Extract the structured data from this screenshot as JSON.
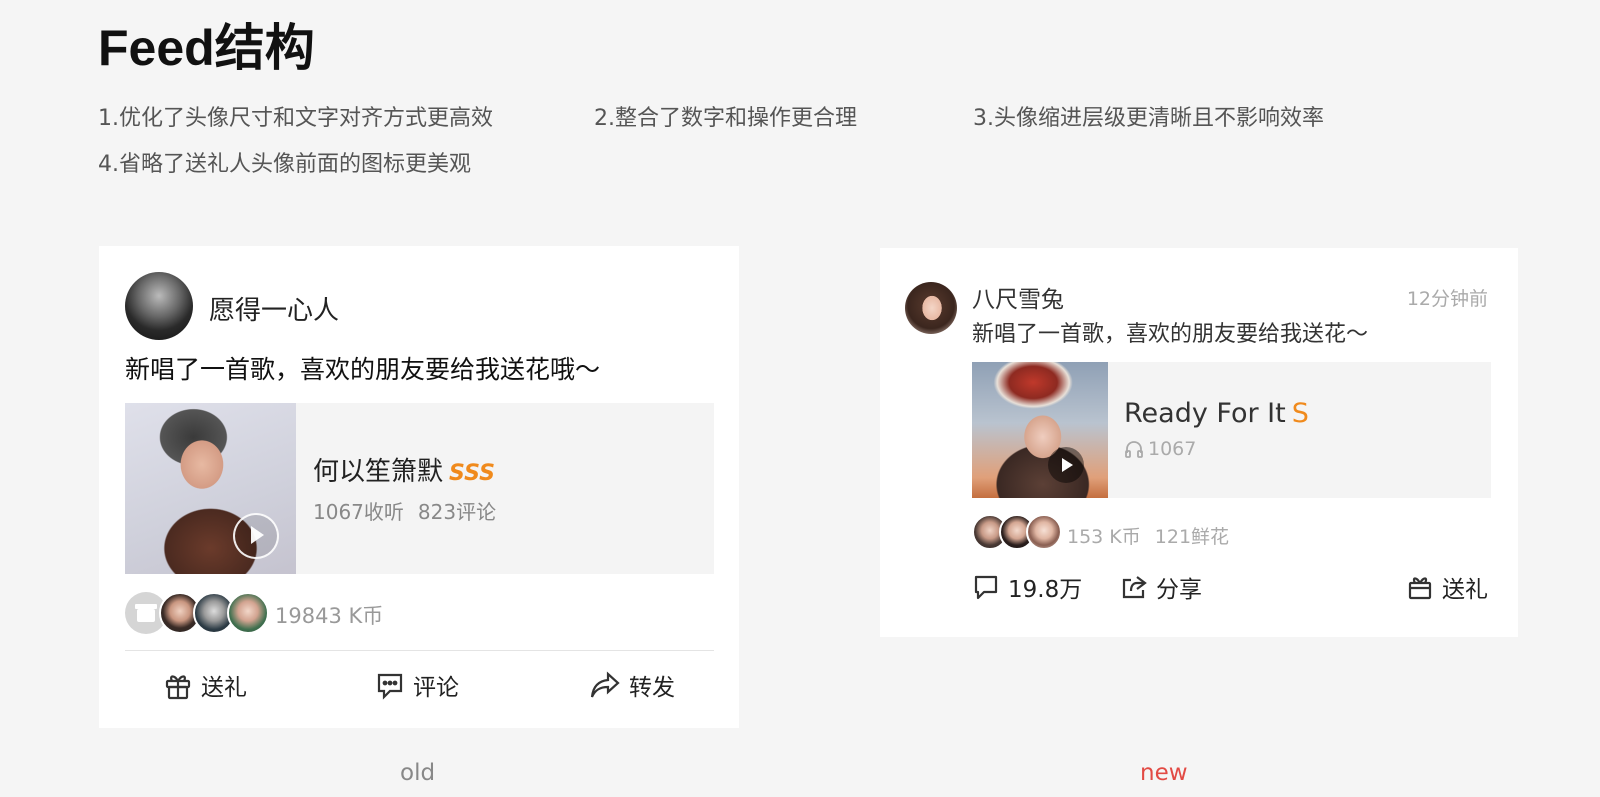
{
  "page": {
    "title": "Feed结构",
    "notes": [
      "1.优化了头像尺寸和文字对齐方式更高效",
      "2.整合了数字和操作更合理",
      "3.头像缩进层级更清晰且不影响效率",
      "4.省略了送礼人头像前面的图标更美观"
    ]
  },
  "old_card": {
    "label": "old",
    "user_name": "愿得一心人",
    "post_text": "新唱了一首歌，喜欢的朋友要给我送花哦～",
    "song_title": "何以笙箫默",
    "song_badge": "SSS",
    "listens": "1067收听",
    "comments": "823评论",
    "coins": "19843 K币",
    "actions": {
      "gift": "送礼",
      "comment": "评论",
      "forward": "转发"
    }
  },
  "new_card": {
    "label": "new",
    "user_name": "八尺雪兔",
    "time": "12分钟前",
    "post_text": "新唱了一首歌，喜欢的朋友要给我送花～",
    "song_title": "Ready For It",
    "song_badge": "S",
    "listens": "1067",
    "coins": "153 K币",
    "flowers": "121鲜花",
    "actions": {
      "comment_count": "19.8万",
      "share": "分享",
      "gift": "送礼"
    }
  },
  "colors": {
    "accent_orange": "#f08a1c",
    "new_label": "#e24a44",
    "background": "#f5f5f5"
  },
  "icons": [
    "gift-icon",
    "comment-icon",
    "forward-icon",
    "share-icon",
    "headphone-icon",
    "play-icon"
  ]
}
